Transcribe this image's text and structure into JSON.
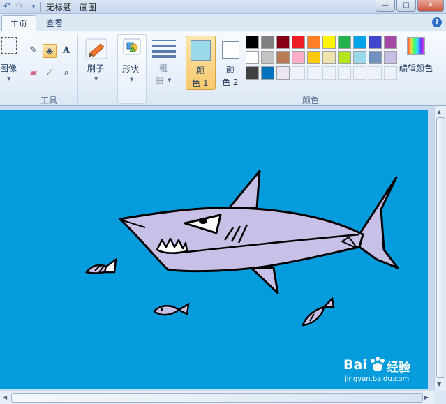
{
  "titlebar": {
    "title": "无标题 - 画图",
    "undo_icon": "undo-icon",
    "redo_icon": "redo-icon",
    "customize_icon": "dropdown-arrow-icon",
    "minimize": "—",
    "maximize": "□",
    "close": "✕"
  },
  "tabs": [
    {
      "label": "主页",
      "active": true
    },
    {
      "label": "查看",
      "active": false
    }
  ],
  "ribbon": {
    "image_group_label": "图像",
    "tools_group_label": "工具",
    "brushes_label": "刷子",
    "shapes_label": "形状",
    "size_label_top": "粗",
    "size_label_bottom": "细",
    "color1_label_top": "颜",
    "color1_label_bottom": "色 1",
    "color2_label_top": "颜",
    "color2_label_bottom": "色 2",
    "colors_group_label": "颜色",
    "edit_colors_label": "编辑颜色",
    "color1_value": "#99d9ea",
    "color2_value": "#ffffff",
    "tools": [
      {
        "name": "pencil-icon",
        "glyph": "✎"
      },
      {
        "name": "fill-bucket-icon",
        "glyph": "◈"
      },
      {
        "name": "text-tool-icon",
        "glyph": "A"
      },
      {
        "name": "eraser-icon",
        "glyph": "▭"
      },
      {
        "name": "color-picker-icon",
        "glyph": "⟋"
      },
      {
        "name": "magnifier-icon",
        "glyph": "⌕"
      }
    ],
    "palette_row1": [
      "#000000",
      "#7f7f7f",
      "#880015",
      "#ed1c24",
      "#ff7f27",
      "#fff200",
      "#22b14c",
      "#00a2e8",
      "#3f48cc",
      "#a349a4"
    ],
    "palette_row2": [
      "#ffffff",
      "#c3c3c3",
      "#b97a57",
      "#ffaec9",
      "#ffc90e",
      "#efe4b0",
      "#b5e61d",
      "#99d9ea",
      "#7092be",
      "#c8bfe7"
    ],
    "palette_row3": [
      "#404040",
      "#0072bc",
      "#ece4f2",
      "",
      "",
      "",
      "",
      "",
      "",
      ""
    ]
  },
  "canvas": {
    "background": "#049cdd",
    "shark_fill": "#c8c0e6"
  },
  "watermark": {
    "brand": "Bai",
    "brand_suffix": "经验",
    "url": "jingyan.baidu.com"
  }
}
